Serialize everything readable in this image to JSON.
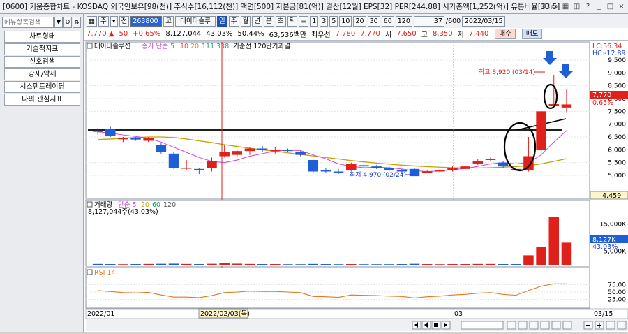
{
  "window": {
    "title": "[0600] 키움종합차트 - KOSDAQ 외국인보유[98(천)] 주식수[16,112(천)] 액면[500] 자본금[81(억)] 결산[12월] EPS[32] PER[244.88] 시가총액[1,252(억)] 유통비율[33.5]",
    "buttons": [
      "⊞",
      "▭",
      "▦",
      "◫",
      "?",
      "_",
      "□",
      "×"
    ]
  },
  "sidebar": {
    "search_placeholder": "메뉴항목검색",
    "search_buttons": [
      "▼",
      "Q",
      "⇅"
    ],
    "items": [
      {
        "label": "차트형태"
      },
      {
        "label": "기술적지표"
      },
      {
        "label": "신호검색"
      },
      {
        "label": "강세/약세"
      },
      {
        "label": "시스템트레이딩"
      },
      {
        "label": "나의 관심지표"
      }
    ]
  },
  "toolbar": {
    "left_buttons": [
      "▦",
      "주",
      "▾",
      "전"
    ],
    "code": "263800",
    "name_prefix": "코",
    "stock_name": "데이타솔루",
    "period_tabs": [
      "일",
      "주",
      "월",
      "년",
      "분",
      "초",
      "틱"
    ],
    "period_selected": "일",
    "settings_icon": "≡",
    "intervals": [
      "1",
      "3",
      "5",
      "10",
      "20",
      "30",
      "60",
      "120"
    ],
    "count": "37",
    "count_total": "/600",
    "date": "2022/03/15"
  },
  "quote": {
    "price": "7,770",
    "change_arrow": "▲",
    "change": "50",
    "change_pct": "+0.65%",
    "volume": "8,127,044",
    "turnover_pct": "43.03%",
    "ratio_pct": "50.44%",
    "amount": "63,536백만",
    "best_ask_label": "최우선",
    "best_ask": "7,780",
    "best_bid": "7,770",
    "open_label": "시",
    "open": "7,650",
    "high_label": "고",
    "high": "8,350",
    "low_label": "저",
    "low": "7,440",
    "buy_label": "매수",
    "sell_label": "매도"
  },
  "chart_data": [
    {
      "type": "candlestick",
      "title": "데이타솔루션",
      "indicators": [
        "종가 단순 5",
        "10",
        "20",
        "111",
        "338",
        "기준선 120",
        "단기과열"
      ],
      "indicator_colors": [
        "#d63fd6",
        "#ff4040",
        "#c8a000",
        "#20a060",
        "#00a0a0",
        "#000000",
        "#000000"
      ],
      "x_start_label": "2022/01",
      "x_mid_label": "03",
      "x_end_label": "03/15",
      "cursor_label": "2022/02/03(목)",
      "ylim": [
        4500,
        9500
      ],
      "yticks": [
        "9,500",
        "9,000",
        "8,500",
        "8,000",
        "7,500",
        "7,000",
        "6,500",
        "6,000",
        "5,500",
        "5,000"
      ],
      "lc_label": "LC:56.34",
      "hc_label": "HC:-12.89",
      "price_tag": "7,770",
      "price_tag_pct": "0.65%",
      "low_tag": "4,459",
      "annotations": {
        "high": "최고 8,920 (03/14)",
        "low": "최저 4,970 (02/24)"
      },
      "candles": [
        {
          "o": 6750,
          "c": 6700,
          "h": 6850,
          "l": 6600
        },
        {
          "o": 6800,
          "c": 6550,
          "h": 6900,
          "l": 6500
        },
        {
          "o": 6450,
          "c": 6450,
          "h": 6500,
          "l": 6300
        },
        {
          "o": 6450,
          "c": 6400,
          "h": 6500,
          "l": 6350
        },
        {
          "o": 6350,
          "c": 6450,
          "h": 6500,
          "l": 6300
        },
        {
          "o": 6200,
          "c": 5900,
          "h": 6250,
          "l": 5850
        },
        {
          "o": 5850,
          "c": 5300,
          "h": 5900,
          "l": 5250
        },
        {
          "o": 5300,
          "c": 5300,
          "h": 5600,
          "l": 5200
        },
        {
          "o": 5250,
          "c": 5200,
          "h": 5300,
          "l": 5050
        },
        {
          "o": 5300,
          "c": 5550,
          "h": 5700,
          "l": 5150
        },
        {
          "o": 5750,
          "c": 5900,
          "h": 6200,
          "l": 5700
        },
        {
          "o": 5800,
          "c": 5950,
          "h": 6000,
          "l": 5750
        },
        {
          "o": 5950,
          "c": 6050,
          "h": 6100,
          "l": 5800
        },
        {
          "o": 6050,
          "c": 6000,
          "h": 6150,
          "l": 5900
        },
        {
          "o": 5950,
          "c": 6000,
          "h": 6100,
          "l": 5850
        },
        {
          "o": 6000,
          "c": 5950,
          "h": 6050,
          "l": 5900
        },
        {
          "o": 5900,
          "c": 5800,
          "h": 5950,
          "l": 5750
        },
        {
          "o": 5600,
          "c": 5150,
          "h": 5650,
          "l": 5100
        },
        {
          "o": 5200,
          "c": 5150,
          "h": 5300,
          "l": 5100
        },
        {
          "o": 5150,
          "c": 5100,
          "h": 5250,
          "l": 5050
        },
        {
          "o": 5200,
          "c": 5450,
          "h": 5500,
          "l": 5150
        },
        {
          "o": 5400,
          "c": 5350,
          "h": 5450,
          "l": 5300
        },
        {
          "o": 5350,
          "c": 5300,
          "h": 5400,
          "l": 5250
        },
        {
          "o": 5300,
          "c": 5200,
          "h": 5350,
          "l": 5150
        },
        {
          "o": 5200,
          "c": 5150,
          "h": 5250,
          "l": 5050
        },
        {
          "o": 5250,
          "c": 4970,
          "h": 5300,
          "l": 4970
        },
        {
          "o": 5150,
          "c": 5150,
          "h": 5200,
          "l": 5100
        },
        {
          "o": 5150,
          "c": 5200,
          "h": 5250,
          "l": 5100
        },
        {
          "o": 5200,
          "c": 5300,
          "h": 5350,
          "l": 5150
        },
        {
          "o": 5250,
          "c": 5350,
          "h": 5400,
          "l": 5200
        },
        {
          "o": 5450,
          "c": 5550,
          "h": 5650,
          "l": 5400
        },
        {
          "o": 5600,
          "c": 5650,
          "h": 5700,
          "l": 5550
        },
        {
          "o": 5500,
          "c": 5350,
          "h": 5550,
          "l": 5300
        },
        {
          "o": 5250,
          "c": 5200,
          "h": 5300,
          "l": 5150
        },
        {
          "o": 5200,
          "c": 5750,
          "h": 6500,
          "l": 5150
        },
        {
          "o": 6000,
          "c": 7500,
          "h": 7500,
          "l": 5800
        },
        {
          "o": 7720,
          "c": 7780,
          "h": 8920,
          "l": 7650
        },
        {
          "o": 7650,
          "c": 7770,
          "h": 8350,
          "l": 7440
        }
      ],
      "ma_short": [
        6700,
        6650,
        6580,
        6520,
        6450,
        6300,
        6100,
        5900,
        5700,
        5550,
        5500,
        5600,
        5750,
        5850,
        5950,
        5980,
        5970,
        5800,
        5650,
        5450,
        5350,
        5300,
        5320,
        5300,
        5250,
        5180,
        5150,
        5170,
        5220,
        5270,
        5350,
        5450,
        5500,
        5450,
        5500,
        5800,
        6300,
        6750
      ],
      "ma_long": [
        6400,
        6420,
        6450,
        6480,
        6500,
        6500,
        6480,
        6420,
        6350,
        6280,
        6200,
        6130,
        6060,
        6000,
        5940,
        5880,
        5820,
        5760,
        5700,
        5640,
        5580,
        5530,
        5480,
        5440,
        5400,
        5370,
        5340,
        5320,
        5300,
        5290,
        5290,
        5300,
        5320,
        5340,
        5380,
        5450,
        5550,
        5650
      ]
    },
    {
      "type": "bar",
      "title": "거래량",
      "legend": [
        "단순 5",
        "20",
        "60",
        "120"
      ],
      "value_label": "8,127,044주(43.03%)",
      "yticks": [
        "15,000K",
        "10,000K",
        "5,000K"
      ],
      "tag": "8,127K",
      "tag_pct": "43.03%",
      "values": [
        300,
        250,
        200,
        250,
        300,
        350,
        400,
        300,
        250,
        350,
        600,
        400,
        300,
        250,
        250,
        200,
        200,
        300,
        250,
        200,
        250,
        200,
        200,
        200,
        250,
        350,
        250,
        200,
        250,
        250,
        300,
        300,
        250,
        250,
        3500,
        6500,
        17500,
        8127
      ],
      "ylim": [
        0,
        18000
      ]
    },
    {
      "type": "line",
      "title": "RSI 14",
      "yticks": [
        "75.00",
        "50.00",
        "25.00"
      ],
      "ylim": [
        0,
        100
      ],
      "values": [
        55,
        52,
        48,
        47,
        49,
        40,
        33,
        33,
        31,
        38,
        48,
        50,
        53,
        52,
        52,
        50,
        48,
        35,
        34,
        32,
        40,
        39,
        38,
        36,
        35,
        30,
        34,
        36,
        40,
        42,
        46,
        48,
        42,
        39,
        55,
        70,
        78,
        78
      ]
    }
  ]
}
